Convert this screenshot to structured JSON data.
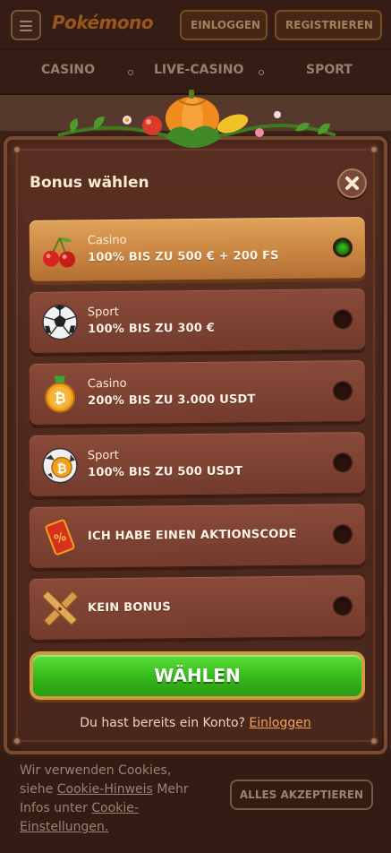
{
  "header": {
    "login_label": "EINLOGGEN",
    "register_label": "REGISTRIEREN",
    "logo_text": "Pokémono"
  },
  "nav": {
    "items": [
      "CASINO",
      "LIVE-CASINO",
      "SPORT"
    ]
  },
  "modal": {
    "title": "Bonus wählen",
    "options": [
      {
        "label": "Casino",
        "title": "100% BIS ZU 500 € + 200 FS",
        "icon": "cherries-icon",
        "selected": true
      },
      {
        "label": "Sport",
        "title": "100% BIS ZU 300 €",
        "icon": "soccer-ball-icon",
        "selected": false
      },
      {
        "label": "Casino",
        "title": "200% BIS ZU 3.000 USDT",
        "icon": "bitcoin-medal-icon",
        "selected": false
      },
      {
        "label": "Sport",
        "title": "100% BIS ZU 500 USDT",
        "icon": "bitcoin-ball-icon",
        "selected": false
      },
      {
        "label": "",
        "title": "ICH HABE EINEN AKTIONSCODE",
        "icon": "promo-ticket-icon",
        "selected": false
      },
      {
        "label": "",
        "title": "KEIN BONUS",
        "icon": "crossed-planks-icon",
        "selected": false
      }
    ],
    "choose_label": "WÄHLEN",
    "login_prompt": "Du hast bereits ein Konto?",
    "login_link": "Einloggen"
  },
  "cookie": {
    "text_1": "Wir verwenden Cookies, siehe",
    "link_1": "Cookie-Hinweis",
    "text_2": "Mehr Infos unter",
    "link_2": "Cookie-Einstellungen.",
    "accept_label": "ALLES AKZEPTIEREN"
  },
  "colors": {
    "accent_green": "#35b81a",
    "selected_option": "#c98642",
    "option_bg": "#733b2d",
    "link": "#f2a35b"
  }
}
